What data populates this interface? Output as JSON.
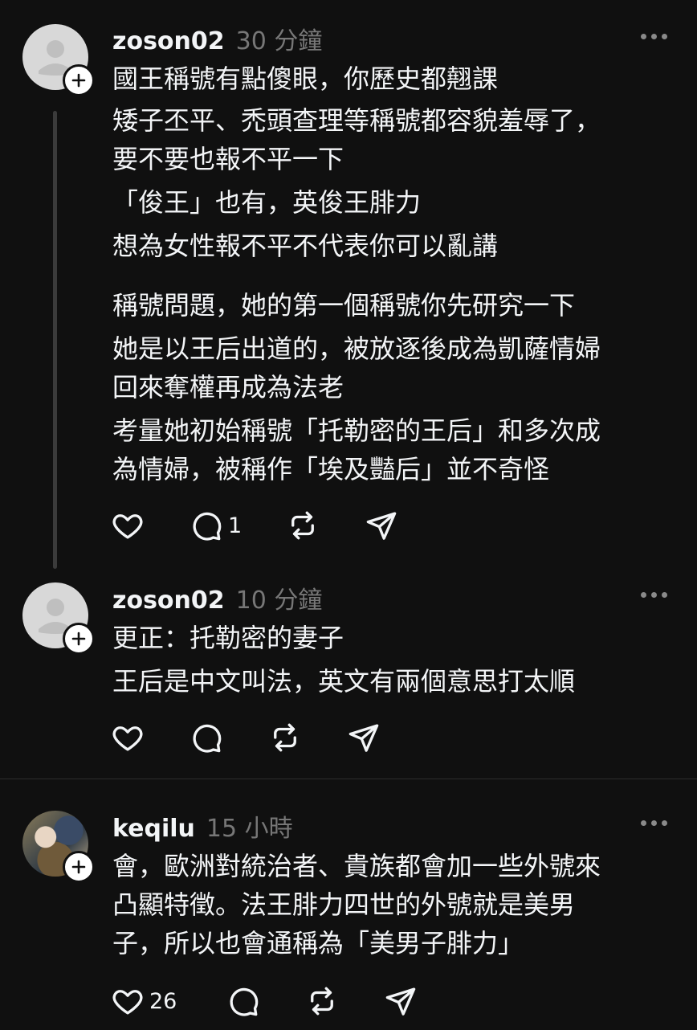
{
  "posts": [
    {
      "username": "zoson02",
      "timestamp": "30 分鐘",
      "lines": [
        "國王稱號有點傻眼，你歷史都翹課",
        "矮子丕平、禿頭查理等稱號都容貌羞辱了，",
        "要不要也報不平一下",
        "「俊王」也有，英俊王腓力",
        "想為女性報不平不代表你可以亂講",
        "",
        "稱號問題，她的第一個稱號你先研究一下",
        "她是以王后出道的，被放逐後成為凱薩情婦",
        "回來奪權再成為法老",
        "考量她初始稱號「托勒密的王后」和多次成",
        "為情婦，被稱作「埃及豔后」並不奇怪"
      ],
      "like_count": "",
      "reply_count": "1"
    },
    {
      "username": "zoson02",
      "timestamp": "10 分鐘",
      "lines": [
        "更正：托勒密的妻子",
        "王后是中文叫法，英文有兩個意思打太順"
      ],
      "like_count": "",
      "reply_count": ""
    },
    {
      "username": "keqilu",
      "timestamp": "15 小時",
      "lines": [
        "會，歐洲對統治者、貴族都會加一些外號來",
        "凸顯特徵。法王腓力四世的外號就是美男",
        "子，所以也會通稱為「美男子腓力」"
      ],
      "like_count": "26",
      "reply_count": ""
    }
  ],
  "icons": {
    "avatar_default": "person-silhouette",
    "follow": "plus-icon",
    "more": "more-horizontal-icon",
    "like": "heart-icon",
    "reply": "comment-bubble-icon",
    "repost": "repost-icon",
    "share": "send-icon"
  },
  "colors": {
    "background": "#101010",
    "text": "#f3f5f7",
    "muted": "#777777",
    "thread_line": "#3b3b3b"
  }
}
